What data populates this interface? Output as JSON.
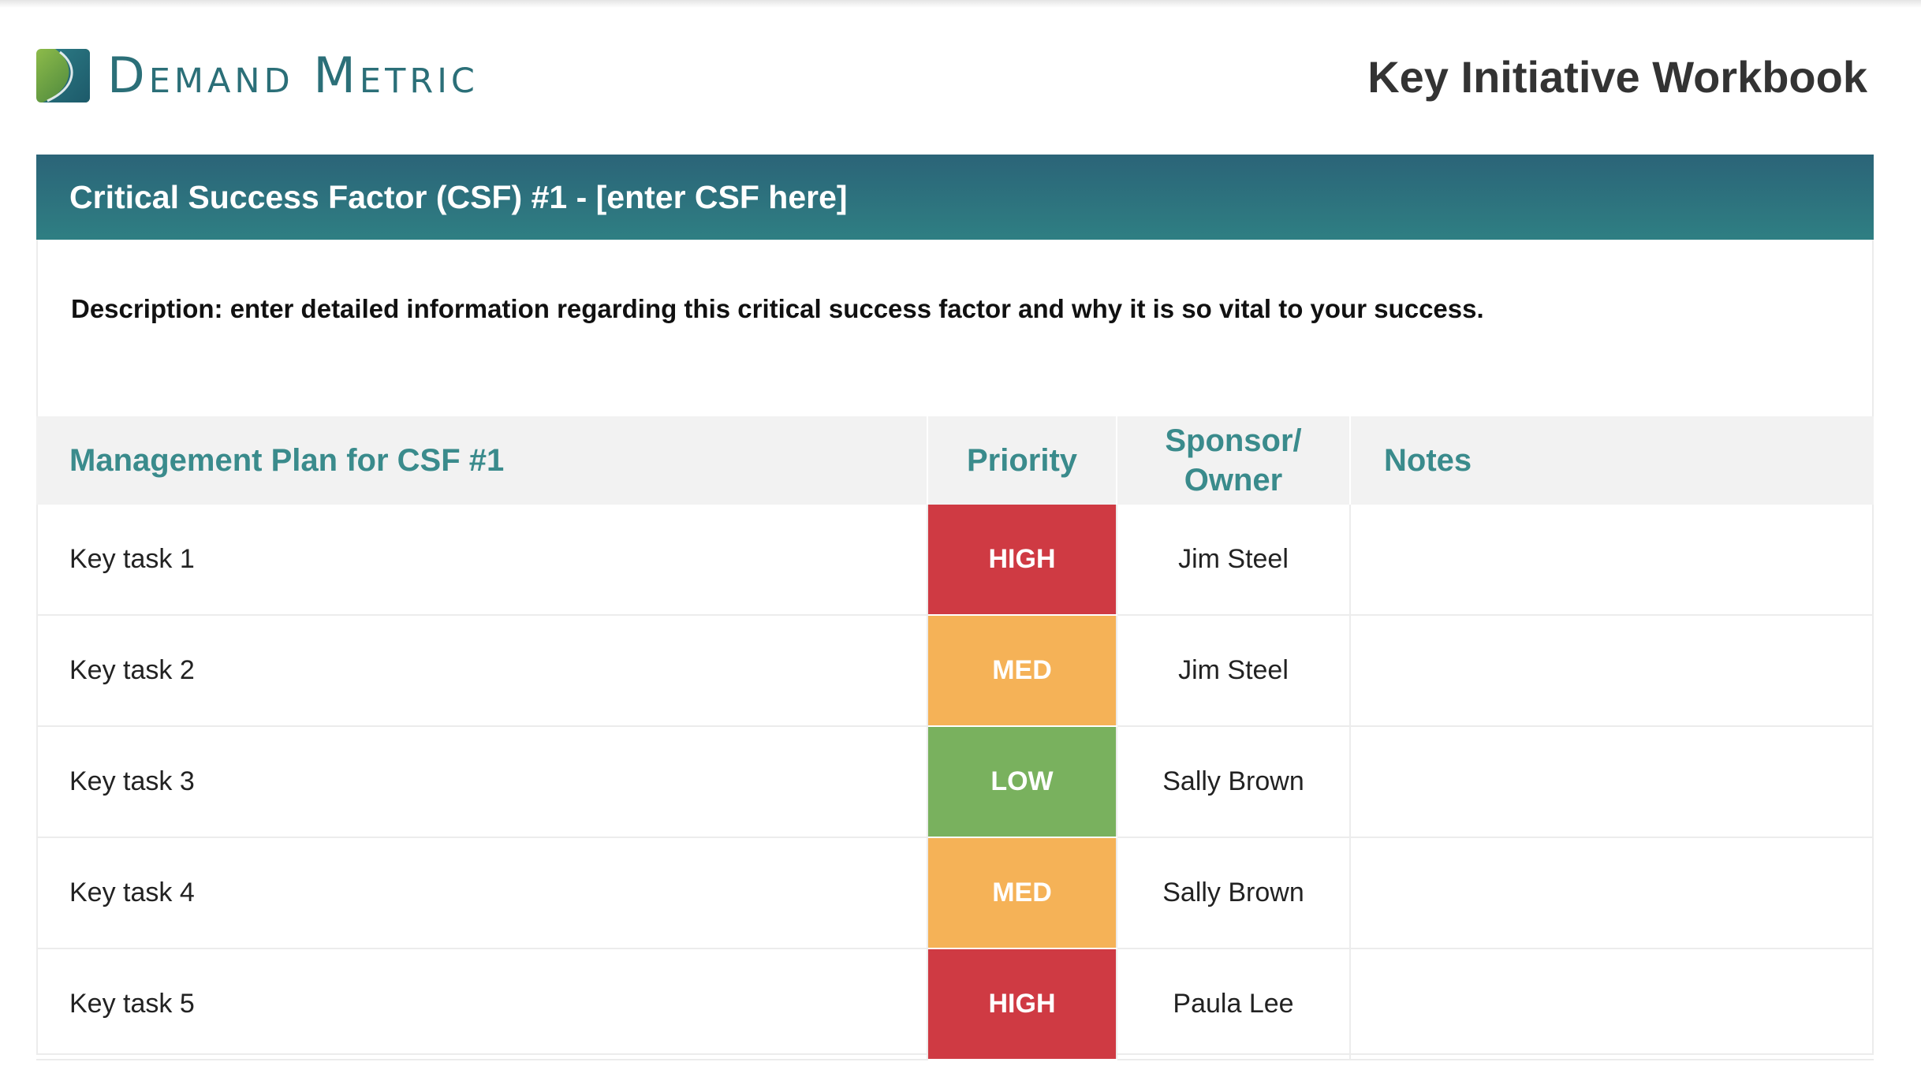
{
  "header": {
    "brand": "Demand Metric",
    "title": "Key Initiative Workbook",
    "logo_icon": "demand-metric-logo-icon",
    "brand_color": "#2b6f78"
  },
  "csf": {
    "title": "Critical Success Factor (CSF) #1 - [enter CSF here]",
    "description": "Description: enter detailed information regarding this critical success factor and why it is so vital to your success.",
    "banner_color": "#2b6f7a"
  },
  "table": {
    "headers": {
      "task": "Management Plan for CSF #1",
      "priority": "Priority",
      "owner_line1": "Sponsor/",
      "owner_line2": "Owner",
      "notes": "Notes"
    },
    "rows": [
      {
        "task": "Key task 1",
        "priority": "HIGH",
        "owner": "Jim Steel",
        "notes": ""
      },
      {
        "task": "Key task 2",
        "priority": "MED",
        "owner": "Jim Steel",
        "notes": ""
      },
      {
        "task": "Key task 3",
        "priority": "LOW",
        "owner": "Sally Brown",
        "notes": ""
      },
      {
        "task": "Key task 4",
        "priority": "MED",
        "owner": "Sally Brown",
        "notes": ""
      },
      {
        "task": "Key task 5",
        "priority": "HIGH",
        "owner": "Paula Lee",
        "notes": ""
      }
    ],
    "priority_colors": {
      "HIGH": "#cf3a43",
      "MED": "#f5b257",
      "LOW": "#79b15e"
    }
  }
}
